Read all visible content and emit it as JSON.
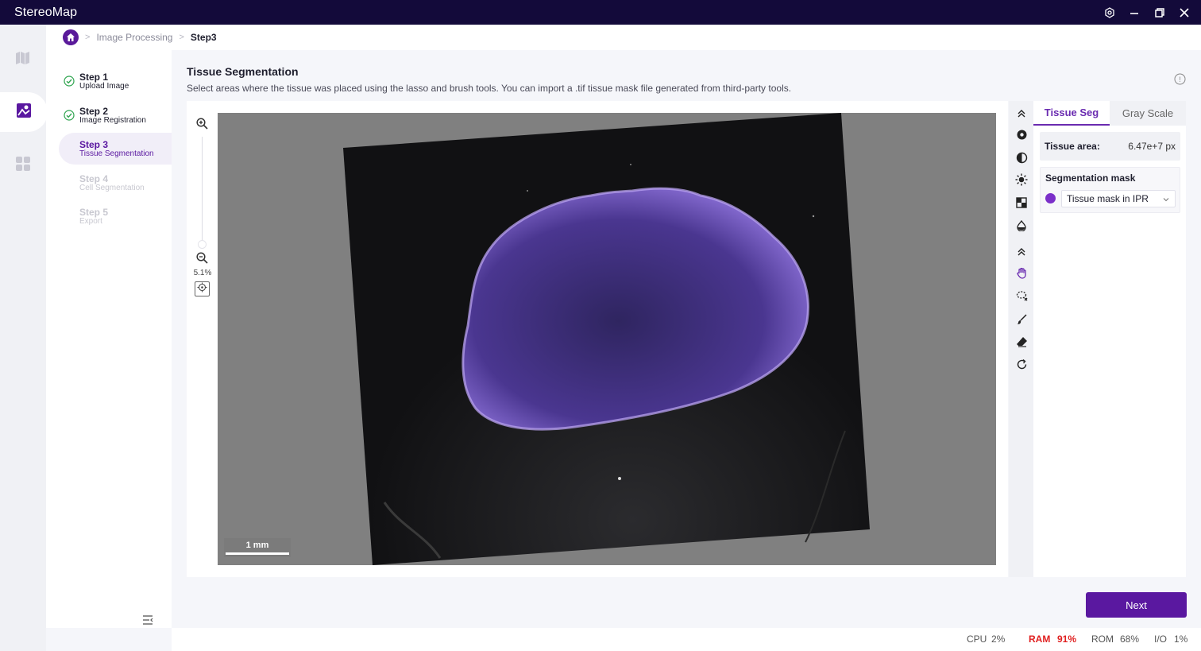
{
  "app": {
    "title": "StereoMap"
  },
  "breadcrumb": {
    "items": [
      "Image Processing",
      "Step3"
    ]
  },
  "steps": [
    {
      "title": "Step 1",
      "subtitle": "Upload Image",
      "state": "done"
    },
    {
      "title": "Step 2",
      "subtitle": "Image Registration",
      "state": "done"
    },
    {
      "title": "Step 3",
      "subtitle": "Tissue Segmentation",
      "state": "active"
    },
    {
      "title": "Step 4",
      "subtitle": "Cell Segmentation",
      "state": "disabled"
    },
    {
      "title": "Step 5",
      "subtitle": "Export",
      "state": "disabled"
    }
  ],
  "main": {
    "title": "Tissue Segmentation",
    "description": "Select areas where the tissue was placed using the lasso and brush tools. You can import a .tif tissue mask file generated from third-party tools."
  },
  "viewer": {
    "zoom": "5.1%",
    "scale_bar": "1 mm"
  },
  "tabs": [
    "Tissue Seg",
    "Gray Scale"
  ],
  "panel": {
    "area_label": "Tissue area:",
    "area_value": "6.47e+7 px",
    "mask_title": "Segmentation mask",
    "mask_selected": "Tissue mask in IPR",
    "mask_color": "#7b2fc9"
  },
  "actions": {
    "next": "Next"
  },
  "status": {
    "cpu_label": "CPU",
    "cpu_value": "2%",
    "ram_label": "RAM",
    "ram_value": "91%",
    "rom_label": "ROM",
    "rom_value": "68%",
    "io_label": "I/O",
    "io_value": "1%"
  },
  "colors": {
    "accent": "#5a18a0",
    "titlebar": "#130a3a",
    "alert": "#e02020"
  }
}
